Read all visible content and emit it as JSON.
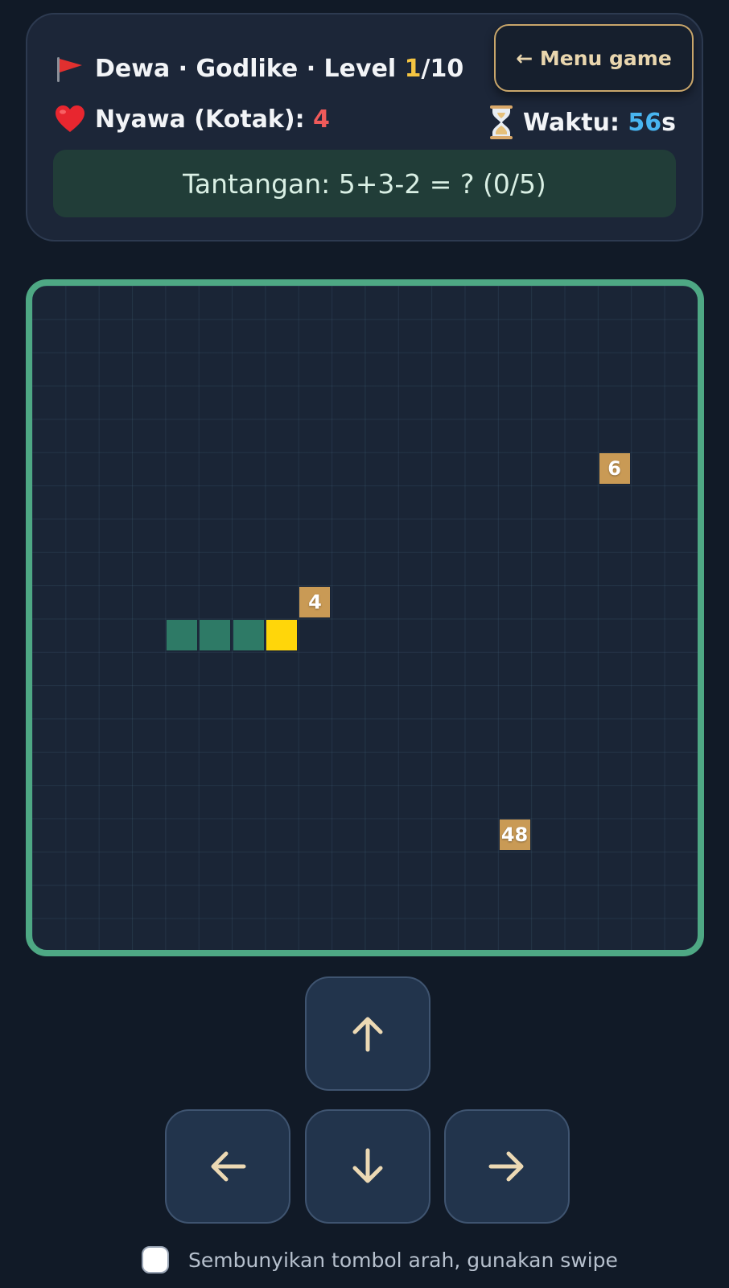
{
  "header": {
    "mode_text": "Dewa · Godlike · Level ",
    "level_current": "1",
    "level_total": "/10",
    "menu_label": "← Menu game",
    "lives_label": "Nyawa (Kotak): ",
    "lives_value": "4",
    "time_label": "Waktu: ",
    "time_value": "56",
    "time_unit": "s",
    "challenge": "Tantangan: 5+3-2 = ? (0/5)"
  },
  "board": {
    "grid_cols": 20,
    "grid_rows": 20,
    "snake": [
      {
        "col": 4,
        "row": 10,
        "part": "body"
      },
      {
        "col": 5,
        "row": 10,
        "part": "body"
      },
      {
        "col": 6,
        "row": 10,
        "part": "body"
      },
      {
        "col": 7,
        "row": 10,
        "part": "head"
      }
    ],
    "foods": [
      {
        "col": 17,
        "row": 5,
        "value": "6"
      },
      {
        "col": 8,
        "row": 9,
        "value": "4"
      },
      {
        "col": 14,
        "row": 16,
        "value": "48"
      }
    ]
  },
  "controls": {
    "up": "arrow-up",
    "left": "arrow-left",
    "down": "arrow-down",
    "right": "arrow-right"
  },
  "options": {
    "hide_arrows_label": "Sembunyikan tombol arah, gunakan swipe",
    "hide_arrows_checked": false
  },
  "colors": {
    "background": "#111a27",
    "board_border": "#4ea884",
    "snake_body": "#2e7a66",
    "snake_head": "#ffd60a",
    "food": "#c99a55",
    "accent_yellow": "#f5c542",
    "lives_red": "#f05a5a",
    "time_blue": "#48b5f0",
    "arrow_color": "#ecd9b4"
  }
}
